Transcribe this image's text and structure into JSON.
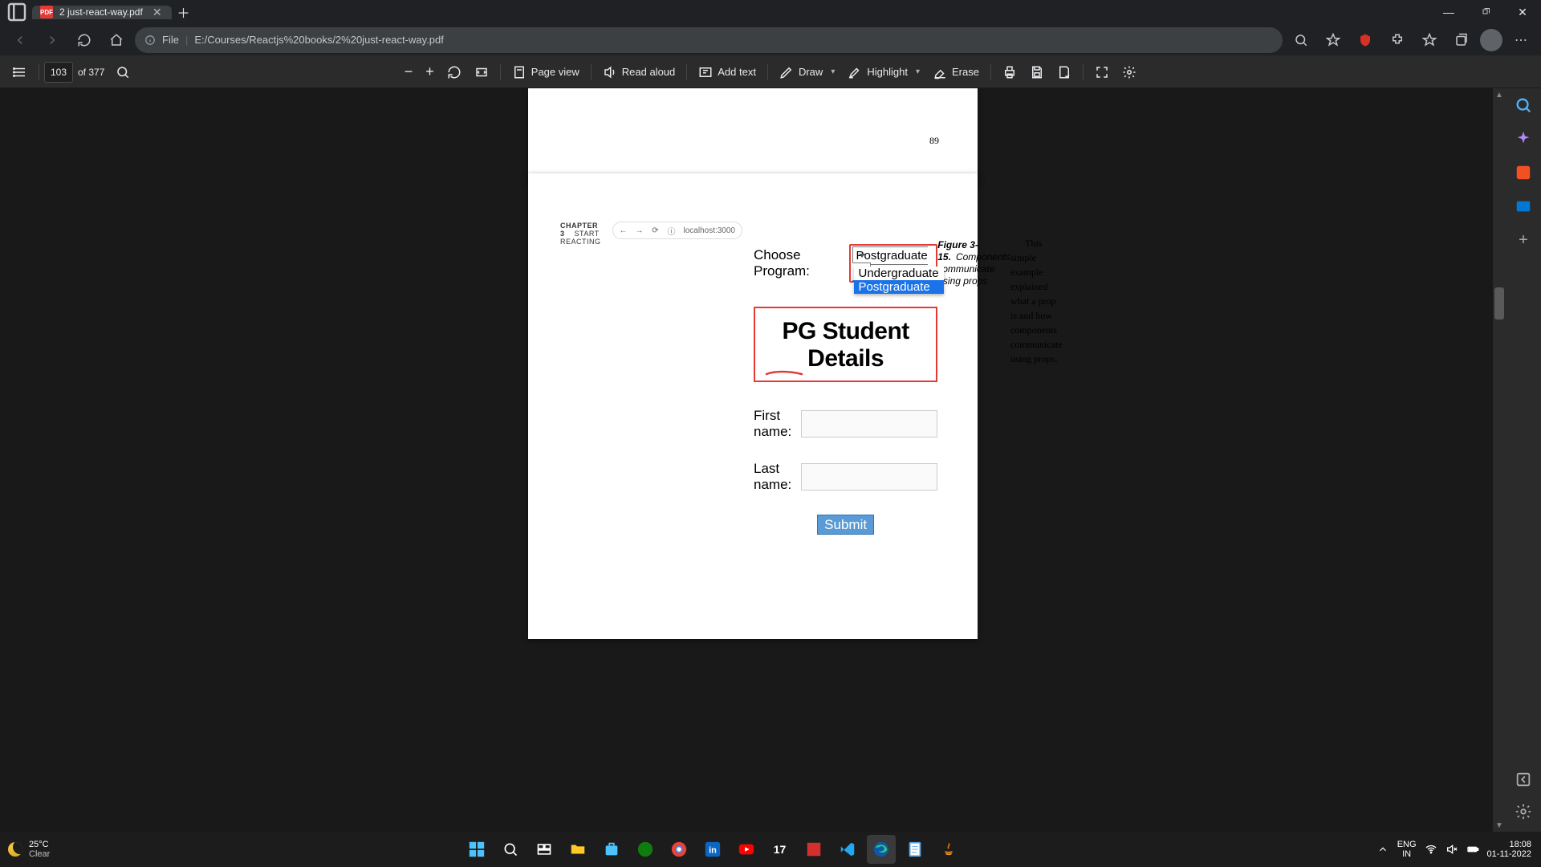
{
  "window": {
    "title": "2 just-react-way.pdf"
  },
  "address": {
    "scheme": "File",
    "url": "E:/Courses/Reactjs%20books/2%20just-react-way.pdf"
  },
  "pdf_toolbar": {
    "page_current": "103",
    "page_total": "of 377",
    "page_view": "Page view",
    "read_aloud": "Read aloud",
    "add_text": "Add text",
    "draw": "Draw",
    "highlight": "Highlight",
    "erase": "Erase"
  },
  "doc": {
    "prev_page_number": "89",
    "chapter_tag": "CHAPTER 3",
    "chapter_title": "START REACTING",
    "inner_url": "localhost:3000",
    "choose_label": "Choose Program:",
    "select_value": "Postgraduate",
    "dropdown": {
      "opt1": "Undergraduate",
      "opt2": "Postgraduate"
    },
    "heading": "PG Student Details",
    "first_name": "First name:",
    "last_name": "Last name:",
    "submit": "Submit",
    "fig_bold": "Figure 3-15.",
    "fig_rest": "Components communicate using props",
    "para": "This simple example explained what a prop is and how components communicate using props."
  },
  "taskbar": {
    "temp": "25°C",
    "cond": "Clear",
    "lang1": "ENG",
    "lang2": "IN",
    "time": "18:08",
    "date": "01-11-2022"
  }
}
